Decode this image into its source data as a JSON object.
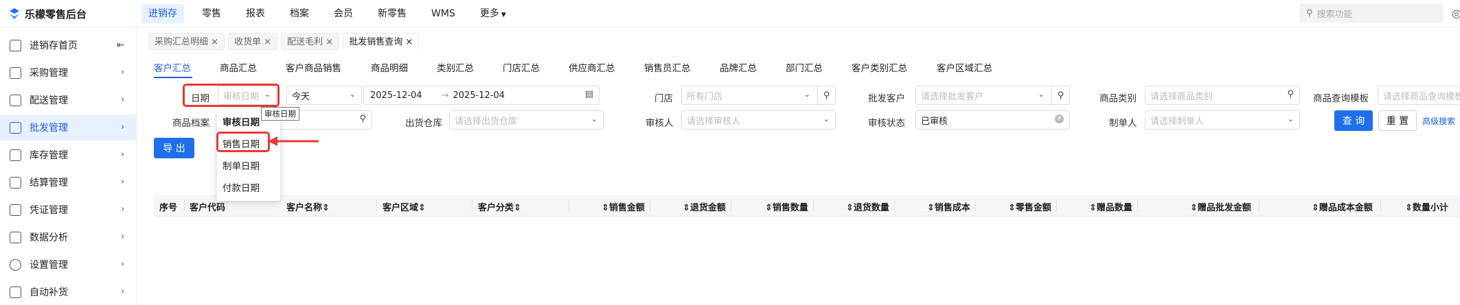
{
  "app": {
    "title": "乐檬零售后台"
  },
  "topnav": {
    "items": [
      "进销存",
      "零售",
      "报表",
      "档案",
      "会员",
      "新零售",
      "WMS",
      "更多"
    ],
    "search_placeholder": "搜索功能"
  },
  "sidebar": {
    "items": [
      {
        "label": "进销存首页",
        "icon": "home-icon"
      },
      {
        "label": "采购管理",
        "icon": "cart-icon"
      },
      {
        "label": "配送管理",
        "icon": "box-icon"
      },
      {
        "label": "批发管理",
        "icon": "wholesale-icon",
        "active": true
      },
      {
        "label": "库存管理",
        "icon": "inventory-icon"
      },
      {
        "label": "结算管理",
        "icon": "dollar-icon"
      },
      {
        "label": "凭证管理",
        "icon": "voucher-icon"
      },
      {
        "label": "数据分析",
        "icon": "chart-icon"
      },
      {
        "label": "设置管理",
        "icon": "gear-icon"
      },
      {
        "label": "自动补货",
        "icon": "restock-icon"
      }
    ]
  },
  "tabs": [
    "采购汇总明细",
    "收货单",
    "配送毛利",
    "批发销售查询"
  ],
  "subtabs": [
    "客户汇总",
    "商品汇总",
    "客户商品销售",
    "商品明细",
    "类别汇总",
    "门店汇总",
    "供应商汇总",
    "销售员汇总",
    "品牌汇总",
    "部门汇总",
    "客户类别汇总",
    "客户区域汇总"
  ],
  "filters": {
    "date_label": "日期",
    "date_type_placeholder": "审核日期",
    "date_range_preset": "今天",
    "date_start": "2025-12-04",
    "date_sep": "→",
    "date_end": "2025-12-04",
    "store_label": "门店",
    "store_placeholder": "所有门店",
    "customer_label": "批发客户",
    "customer_placeholder": "请选择批发客户",
    "category_label": "商品类别",
    "category_placeholder": "请选择商品类别",
    "template_label": "商品查询模板",
    "template_placeholder": "请选择商品查询模板",
    "product_label": "商品档案",
    "warehouse_label": "出货仓库",
    "warehouse_placeholder": "请选择出货仓库",
    "auditor_label": "审核人",
    "auditor_placeholder": "请选择审核人",
    "audit_status_label": "审核状态",
    "audit_status_value": "已审核",
    "creator_label": "制单人",
    "creator_placeholder": "请选择制单人",
    "query_button": "查 询",
    "reset_button": "重 置",
    "advanced_link": "高级搜索"
  },
  "export_button": "导 出",
  "date_type_dropdown": {
    "options": [
      "审核日期",
      "销售日期",
      "制单日期",
      "付款日期"
    ],
    "selected": "审核日期",
    "tooltip": "审核日期"
  },
  "table": {
    "columns": [
      "序号",
      "客户代码",
      "客户名称",
      "客户区域",
      "客户分类",
      "销售金额",
      "退货金额",
      "销售数量",
      "退货数量",
      "销售成本",
      "零售金额",
      "赠品数量",
      "赠品批发金额",
      "赠品成本金额",
      "数量小计"
    ]
  },
  "colors": {
    "accent": "#1f6feb",
    "highlight": "#e53935"
  }
}
